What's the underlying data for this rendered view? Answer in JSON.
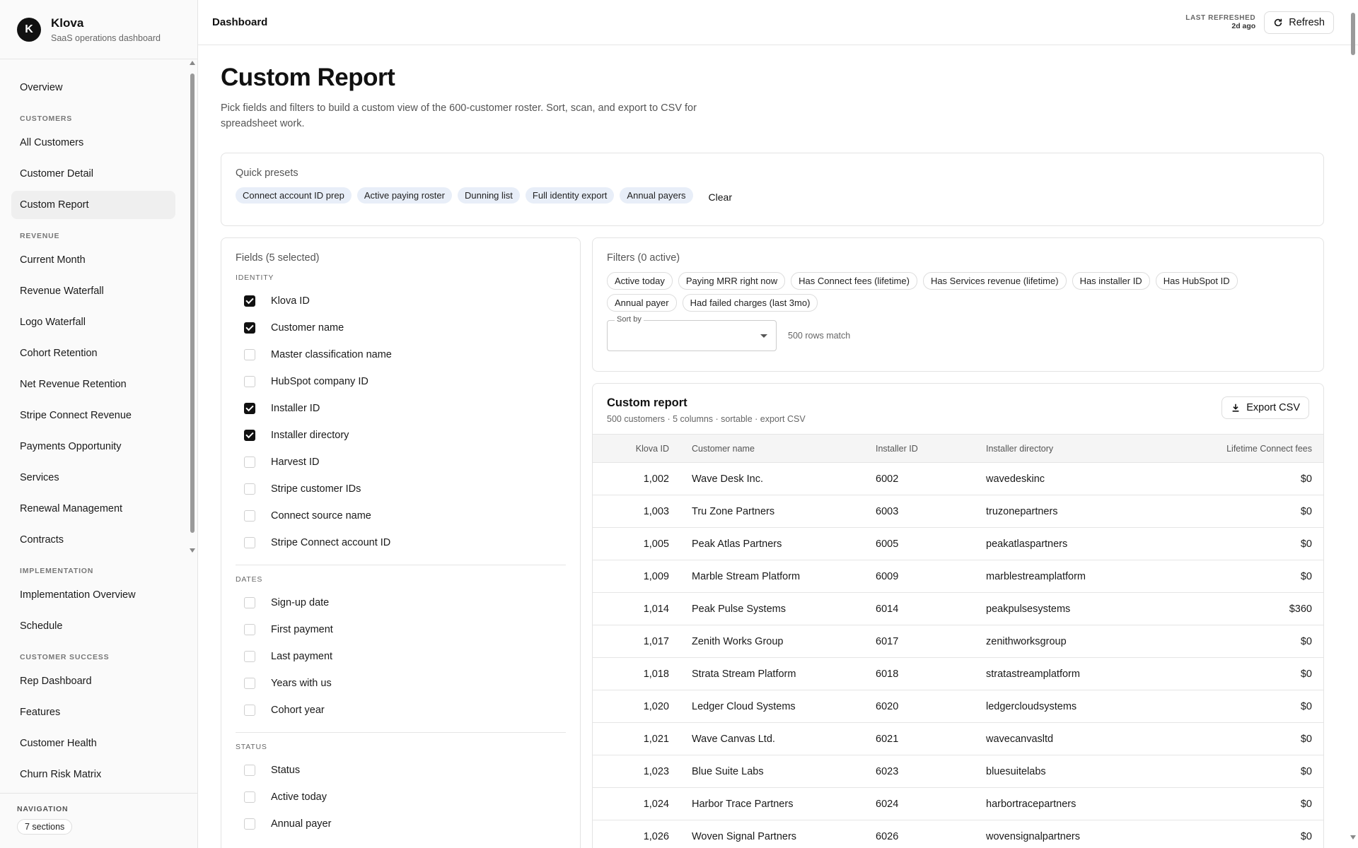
{
  "brand": {
    "initial": "K",
    "name": "Klova",
    "subtitle": "SaaS operations dashboard"
  },
  "sidebar": {
    "overview": "Overview",
    "sections": [
      {
        "title": "CUSTOMERS",
        "items": [
          "All Customers",
          "Customer Detail",
          "Custom Report"
        ]
      },
      {
        "title": "REVENUE",
        "items": [
          "Current Month",
          "Revenue Waterfall",
          "Logo Waterfall",
          "Cohort Retention",
          "Net Revenue Retention",
          "Stripe Connect Revenue",
          "Payments Opportunity",
          "Services",
          "Renewal Management",
          "Contracts"
        ]
      },
      {
        "title": "IMPLEMENTATION",
        "items": [
          "Implementation Overview",
          "Schedule"
        ]
      },
      {
        "title": "CUSTOMER SUCCESS",
        "items": [
          "Rep Dashboard",
          "Features",
          "Customer Health",
          "Churn Risk Matrix"
        ]
      }
    ],
    "active": "Custom Report",
    "footer": {
      "label": "NAVIGATION",
      "badge": "7 sections"
    }
  },
  "topbar": {
    "title": "Dashboard",
    "refreshed_label": "LAST REFRESHED",
    "refreshed_value": "2d ago",
    "refresh_button": "Refresh"
  },
  "page": {
    "title": "Custom Report",
    "description": "Pick fields and filters to build a custom view of the 600-customer roster. Sort, scan, and export to CSV for spreadsheet work."
  },
  "presets": {
    "label": "Quick presets",
    "items": [
      "Connect account ID prep",
      "Active paying roster",
      "Dunning list",
      "Full identity export",
      "Annual payers"
    ],
    "clear": "Clear"
  },
  "fields": {
    "label": "Fields (5 selected)",
    "groups": [
      {
        "title": "IDENTITY",
        "items": [
          {
            "name": "Klova ID",
            "checked": true
          },
          {
            "name": "Customer name",
            "checked": true
          },
          {
            "name": "Master classification name",
            "checked": false
          },
          {
            "name": "HubSpot company ID",
            "checked": false
          },
          {
            "name": "Installer ID",
            "checked": true
          },
          {
            "name": "Installer directory",
            "checked": true
          },
          {
            "name": "Harvest ID",
            "checked": false
          },
          {
            "name": "Stripe customer IDs",
            "checked": false
          },
          {
            "name": "Connect source name",
            "checked": false
          },
          {
            "name": "Stripe Connect account ID",
            "checked": false
          }
        ]
      },
      {
        "title": "DATES",
        "items": [
          {
            "name": "Sign-up date",
            "checked": false
          },
          {
            "name": "First payment",
            "checked": false
          },
          {
            "name": "Last payment",
            "checked": false
          },
          {
            "name": "Years with us",
            "checked": false
          },
          {
            "name": "Cohort year",
            "checked": false
          }
        ]
      },
      {
        "title": "STATUS",
        "items": [
          {
            "name": "Status",
            "checked": false
          },
          {
            "name": "Active today",
            "checked": false
          },
          {
            "name": "Annual payer",
            "checked": false
          }
        ]
      }
    ]
  },
  "filters": {
    "label": "Filters (0 active)",
    "items": [
      "Active today",
      "Paying MRR right now",
      "Has Connect fees (lifetime)",
      "Has Services revenue (lifetime)",
      "Has installer ID",
      "Has HubSpot ID",
      "Annual payer",
      "Had failed charges (last 3mo)"
    ],
    "sort_label": "Sort by",
    "sort_value": "",
    "match": "500 rows match"
  },
  "report": {
    "title": "Custom report",
    "subtitle": "500 customers · 5 columns · sortable · export CSV",
    "export_button": "Export CSV",
    "columns": [
      "Klova ID",
      "Customer name",
      "Installer ID",
      "Installer directory",
      "Lifetime Connect fees"
    ],
    "rows": [
      [
        "1,002",
        "Wave Desk Inc.",
        "6002",
        "wavedeskinc",
        "$0"
      ],
      [
        "1,003",
        "Tru Zone Partners",
        "6003",
        "truzonepartners",
        "$0"
      ],
      [
        "1,005",
        "Peak Atlas Partners",
        "6005",
        "peakatlaspartners",
        "$0"
      ],
      [
        "1,009",
        "Marble Stream Platform",
        "6009",
        "marblestreamplatform",
        "$0"
      ],
      [
        "1,014",
        "Peak Pulse Systems",
        "6014",
        "peakpulsesystems",
        "$360"
      ],
      [
        "1,017",
        "Zenith Works Group",
        "6017",
        "zenithworksgroup",
        "$0"
      ],
      [
        "1,018",
        "Strata Stream Platform",
        "6018",
        "stratastreamplatform",
        "$0"
      ],
      [
        "1,020",
        "Ledger Cloud Systems",
        "6020",
        "ledgercloudsystems",
        "$0"
      ],
      [
        "1,021",
        "Wave Canvas Ltd.",
        "6021",
        "wavecanvasltd",
        "$0"
      ],
      [
        "1,023",
        "Blue Suite Labs",
        "6023",
        "bluesuitelabs",
        "$0"
      ],
      [
        "1,024",
        "Harbor Trace Partners",
        "6024",
        "harbortracepartners",
        "$0"
      ],
      [
        "1,026",
        "Woven Signal Partners",
        "6026",
        "wovensignalpartners",
        "$0"
      ]
    ]
  }
}
